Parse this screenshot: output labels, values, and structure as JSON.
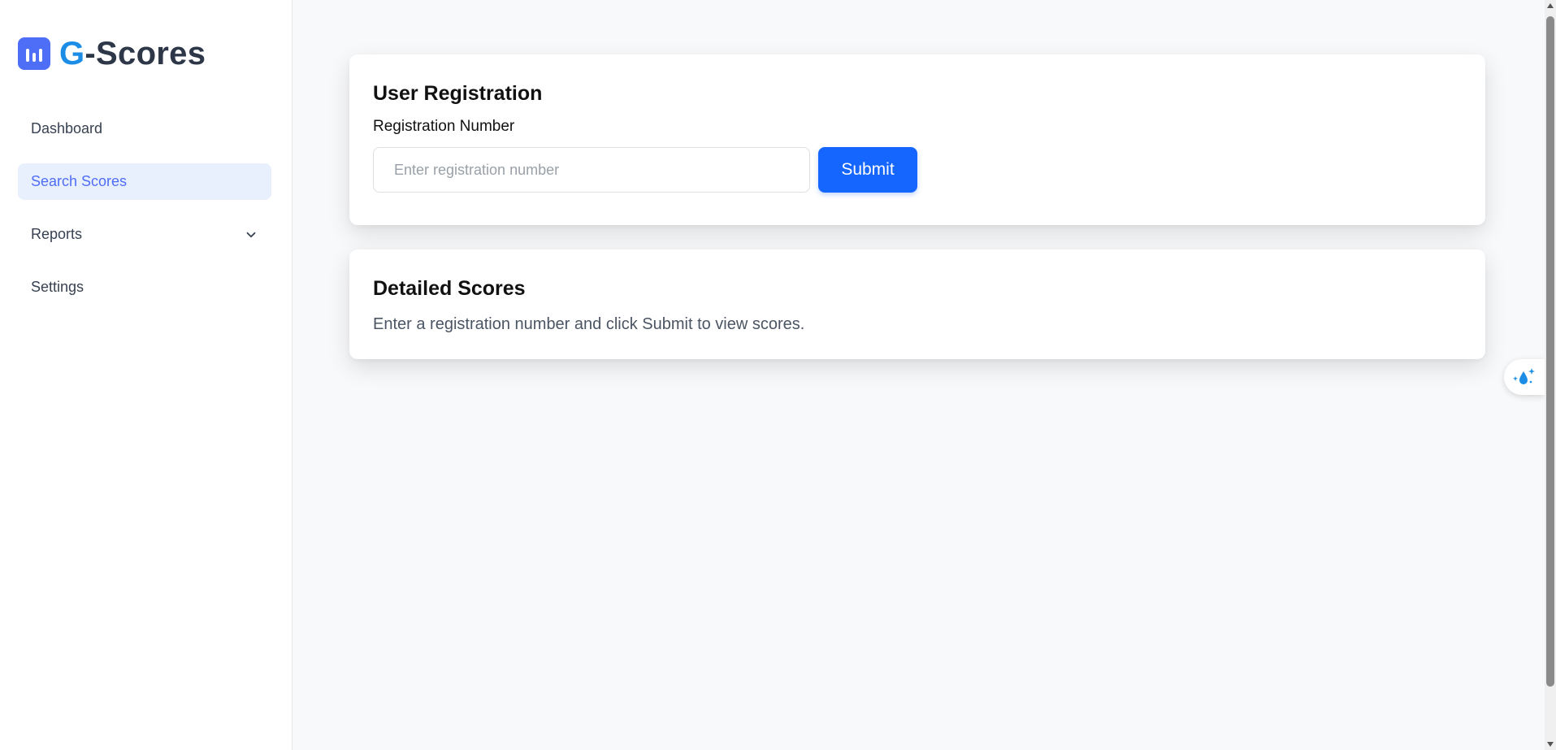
{
  "brand": {
    "accent_letter": "G",
    "rest": "-Scores",
    "logo_icon": "bar-chart-icon",
    "colors": {
      "logo_bg": "#4f6ef7",
      "accent": "#1b8de6",
      "text": "#2d3748"
    }
  },
  "sidebar": {
    "items": [
      {
        "label": "Dashboard",
        "active": false
      },
      {
        "label": "Search Scores",
        "active": true
      },
      {
        "label": "Reports",
        "active": false,
        "icon": "chevron-down-icon"
      },
      {
        "label": "Settings",
        "active": false
      }
    ],
    "active_color": "#4f6ef7",
    "active_bg": "#e8effd"
  },
  "registration": {
    "title": "User Registration",
    "field_label": "Registration Number",
    "placeholder": "Enter registration number",
    "value": "",
    "submit_label": "Submit",
    "submit_color": "#1565ff"
  },
  "scores": {
    "title": "Detailed Scores",
    "message": "Enter a registration number and click Submit to view scores."
  },
  "floating_button": {
    "icon": "sparkle-drop-icon",
    "color": "#1b8de6"
  }
}
